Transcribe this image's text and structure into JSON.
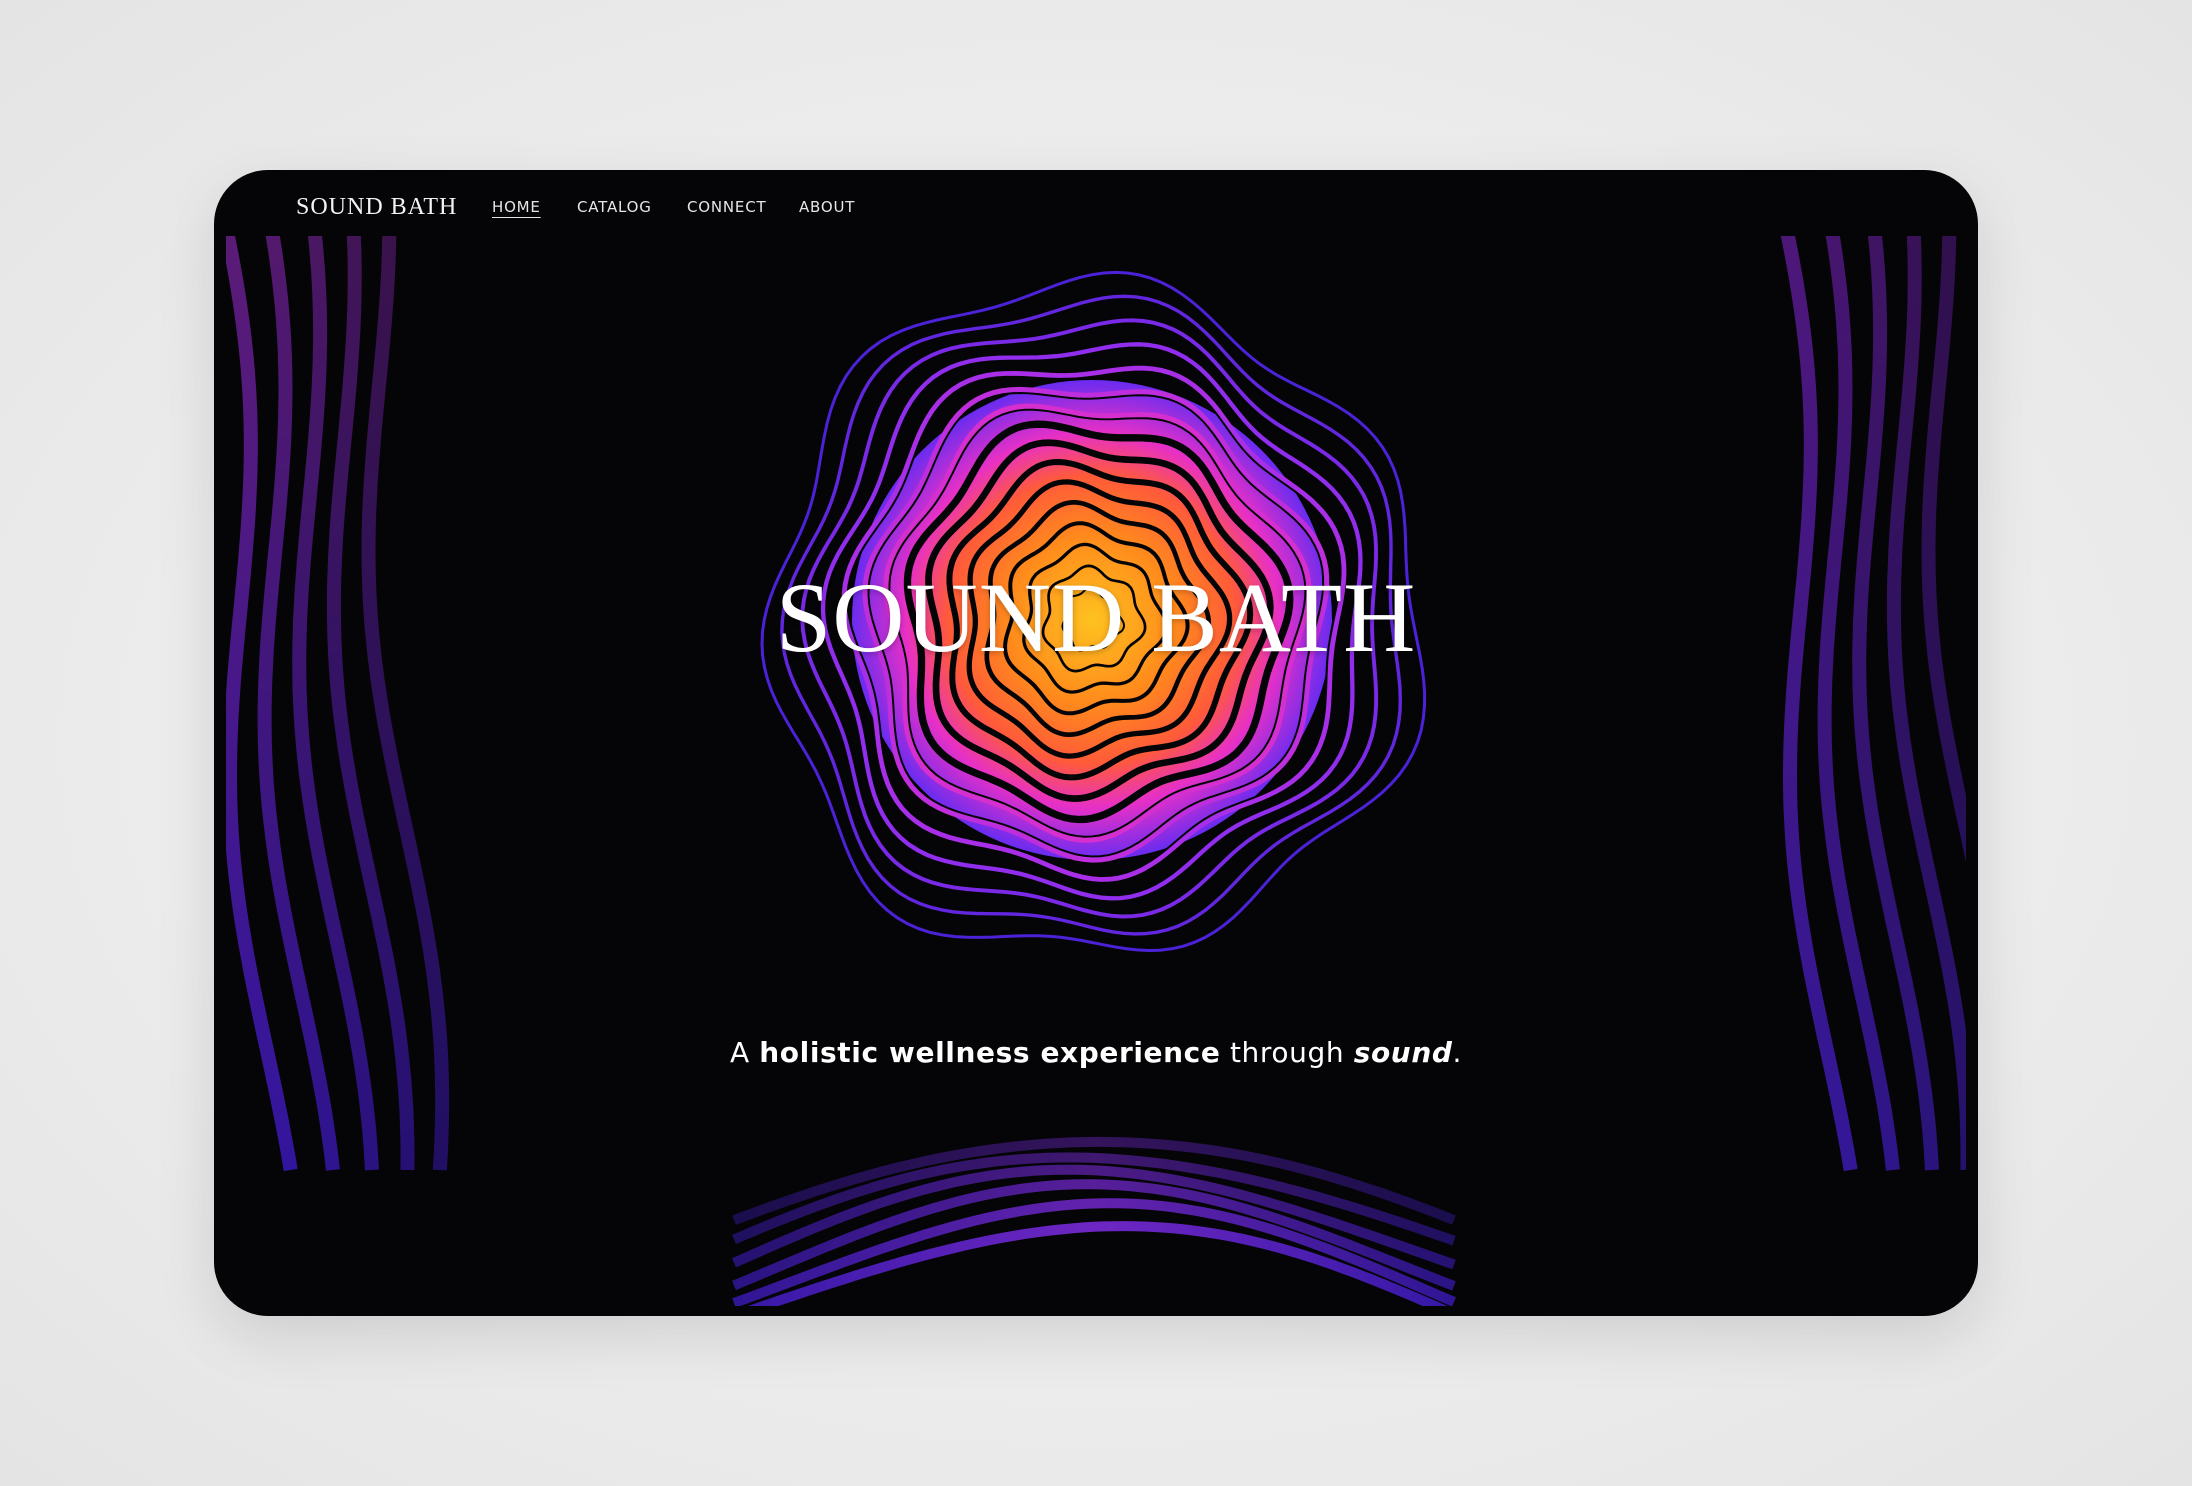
{
  "brand": "SOUND BATH",
  "nav": {
    "home": "HOME",
    "catalog": "CATALOG",
    "connect": "CONNECT",
    "about": "ABOUT"
  },
  "hero": {
    "title": "SOUND BATH",
    "tagline": {
      "prefix": "A ",
      "bold": "holistic wellness experience",
      "middle": " through ",
      "emphasis": "sound",
      "suffix": "."
    }
  },
  "colors": {
    "background": "#050507",
    "outer": "#ececec",
    "glow_core": "#ffb01f",
    "glow_mid": "#ff6a2a",
    "ring_pink": "#e72fc6",
    "ring_purple": "#7c2cf0",
    "ring_indigo": "#4b22d8"
  }
}
